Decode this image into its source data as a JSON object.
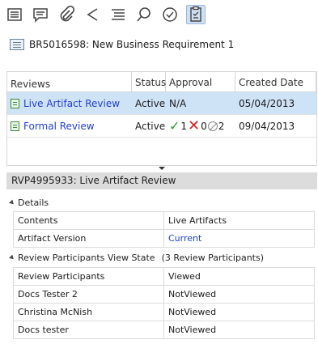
{
  "toolbar": {
    "buttons": [
      {
        "icon": "overview-icon"
      },
      {
        "icon": "comments-icon"
      },
      {
        "icon": "attachments-icon"
      },
      {
        "icon": "share-icon"
      },
      {
        "icon": "history-icon"
      },
      {
        "icon": "search-icon"
      },
      {
        "icon": "approvals-icon"
      },
      {
        "icon": "reviews-icon",
        "active": true
      }
    ]
  },
  "requirement": {
    "title": "BR5016598: New Business Requirement 1"
  },
  "reviews_grid": {
    "columns": [
      "Reviews",
      "Status",
      "Approval",
      "Created Date"
    ],
    "rows": [
      {
        "name": "Live Artifact Review",
        "status": "Active",
        "approval": "N/A",
        "created": "05/04/2013",
        "selected": true
      },
      {
        "name": "Formal Review",
        "status": "Active",
        "approval_counts": {
          "approved": "1",
          "rejected": "0",
          "abstained": "2"
        },
        "created": "09/04/2013"
      }
    ]
  },
  "detail": {
    "header": "RVP4995933: Live Artifact Review",
    "details_section": "Details",
    "details_rows": [
      {
        "label": "Contents",
        "value": "Live Artifacts"
      },
      {
        "label": "Artifact Version",
        "value": "Current"
      }
    ],
    "participants_section": "Review Participants View State",
    "participants_count": "(3 Review Participants)",
    "participants_columns": [
      "Review Participants",
      "Viewed"
    ],
    "participants": [
      {
        "name": "Docs Tester 2",
        "state": "NotViewed"
      },
      {
        "name": "Christina McNish",
        "state": "NotViewed"
      },
      {
        "name": "Docs tester",
        "state": "NotViewed"
      }
    ]
  },
  "colors": {
    "link": "#1f3fd0",
    "selected_row": "#cfe3f7",
    "approved": "#2a9d2a",
    "rejected": "#d42222"
  }
}
